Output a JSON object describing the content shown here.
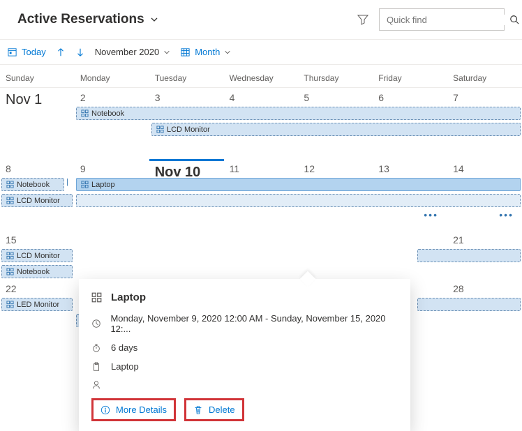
{
  "header": {
    "title": "Active Reservations",
    "search_placeholder": "Quick find"
  },
  "toolbar": {
    "today": "Today",
    "month_label": "November 2020",
    "view": "Month"
  },
  "weekdays": [
    "Sunday",
    "Monday",
    "Tuesday",
    "Wednesday",
    "Thursday",
    "Friday",
    "Saturday"
  ],
  "dates": {
    "r1": [
      "Nov 1",
      "2",
      "3",
      "4",
      "5",
      "6",
      "7"
    ],
    "r2": [
      "8",
      "9",
      "Nov 10",
      "11",
      "12",
      "13",
      "14"
    ],
    "r3": [
      "15",
      "",
      "",
      "",
      "",
      "",
      "21"
    ],
    "r4": [
      "22",
      "",
      "",
      "",
      "",
      "",
      "28"
    ]
  },
  "events": {
    "notebook": "Notebook",
    "lcd": "LCD Monitor",
    "laptop": "Laptop",
    "led": "LED Monitor"
  },
  "popup": {
    "title": "Laptop",
    "range": "Monday, November 9, 2020 12:00 AM - Sunday, November 15, 2020 12:...",
    "duration": "6 days",
    "category": "Laptop",
    "more": "More Details",
    "delete": "Delete"
  }
}
